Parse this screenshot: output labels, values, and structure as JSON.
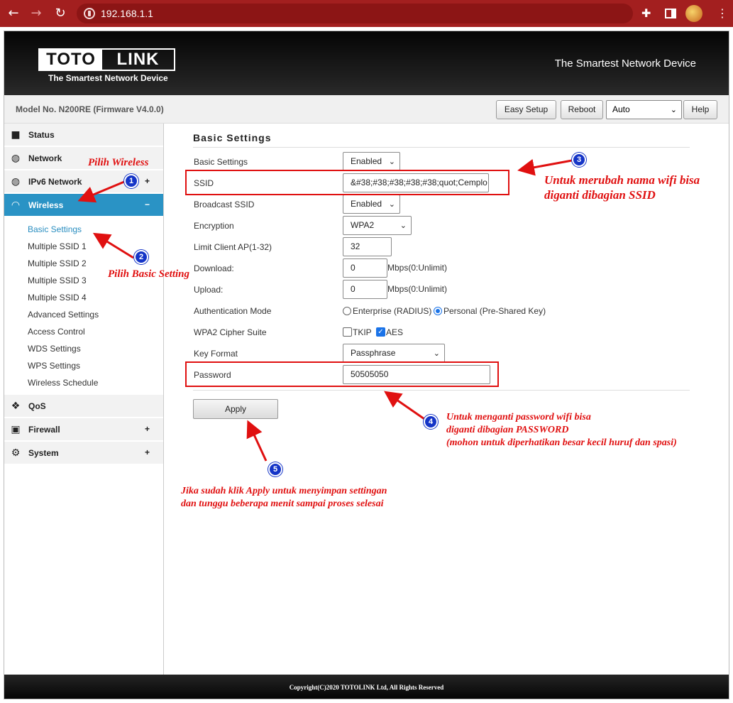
{
  "browser": {
    "url": "192.168.1.1"
  },
  "header": {
    "logo_left": "TOTO",
    "logo_right": "LINK",
    "logo_tagline": "The Smartest Network Device",
    "tagline": "The Smartest Network Device"
  },
  "toolbar": {
    "model": "Model No. N200RE (Firmware V4.0.0)",
    "easy_setup": "Easy Setup",
    "reboot": "Reboot",
    "language": "Auto",
    "help": "Help"
  },
  "sidebar": {
    "items": [
      {
        "label": "Status",
        "icon": "chat-bubble-icon",
        "sign": ""
      },
      {
        "label": "Network",
        "icon": "globe-icon",
        "sign": ""
      },
      {
        "label": "IPv6 Network",
        "icon": "globe-icon",
        "sign": "+"
      },
      {
        "label": "Wireless",
        "icon": "wifi-icon",
        "sign": "−"
      },
      {
        "label": "QoS",
        "icon": "qos-icon",
        "sign": ""
      },
      {
        "label": "Firewall",
        "icon": "lock-icon",
        "sign": "+"
      },
      {
        "label": "System",
        "icon": "gear-icon",
        "sign": "+"
      }
    ],
    "wireless_sub": [
      "Basic Settings",
      "Multiple SSID 1",
      "Multiple SSID 2",
      "Multiple SSID 3",
      "Multiple SSID 4",
      "Advanced Settings",
      "Access Control",
      "WDS Settings",
      "WPS Settings",
      "Wireless Schedule"
    ]
  },
  "content": {
    "title": "Basic Settings",
    "rows": {
      "basic_settings": {
        "label": "Basic Settings",
        "value": "Enabled"
      },
      "ssid": {
        "label": "SSID",
        "value": "&#38;#38;#38;#38;#38;quot;Cemplo"
      },
      "broadcast_ssid": {
        "label": "Broadcast SSID",
        "value": "Enabled"
      },
      "encryption": {
        "label": "Encryption",
        "value": "WPA2"
      },
      "limit_client": {
        "label": "Limit Client AP(1-32)",
        "value": "32"
      },
      "download": {
        "label": "Download:",
        "value": "0",
        "unit": "Mbps(0:Unlimit)"
      },
      "upload": {
        "label": "Upload:",
        "value": "0",
        "unit": "Mbps(0:Unlimit)"
      },
      "auth_mode": {
        "label": "Authentication Mode",
        "option1": "Enterprise (RADIUS)",
        "option2": "Personal (Pre-Shared Key)",
        "selected": "Personal (Pre-Shared Key)"
      },
      "cipher": {
        "label": "WPA2 Cipher Suite",
        "option1": "TKIP",
        "option2": "AES",
        "checked": [
          "AES"
        ]
      },
      "key_format": {
        "label": "Key Format",
        "value": "Passphrase"
      },
      "password": {
        "label": "Password",
        "value": "50505050"
      }
    },
    "apply": "Apply"
  },
  "footer": {
    "copyright": "Copyright(C)2020 TOTOLINK Ltd, All Rights Reserved"
  },
  "annotations": {
    "a1": {
      "num": "1",
      "text": "Pilih Wireless"
    },
    "a2": {
      "num": "2",
      "text": "Pilih Basic Setting"
    },
    "a3": {
      "num": "3",
      "line1": "Untuk merubah nama wifi bisa",
      "line2": "diganti dibagian SSID"
    },
    "a4": {
      "num": "4",
      "line1": "Untuk menganti password wifi bisa",
      "line2": "diganti dibagian PASSWORD",
      "line3": "(mohon untuk diperhatikan besar kecil huruf dan spasi)"
    },
    "a5": {
      "num": "5",
      "line1": "Jika sudah klik Apply untuk menyimpan settingan",
      "line2": "dan tunggu beberapa menit sampai proses selesai"
    },
    "color": "#e01010",
    "badge_color": "#1535c7"
  },
  "colors": {
    "browser_bar": "#a31f1f",
    "accent": "#2a93c5",
    "header_bg": "#111111"
  }
}
